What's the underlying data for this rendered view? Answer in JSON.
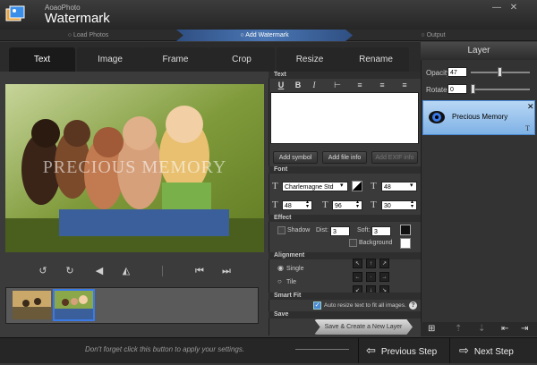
{
  "app": {
    "company": "AoaoPhoto",
    "title": "Watermark"
  },
  "steps": [
    "Load Photos",
    "Add Watermark",
    "Output"
  ],
  "tabs": [
    "Text",
    "Image",
    "Frame",
    "Crop",
    "Resize",
    "Rename"
  ],
  "preview": {
    "watermark_text": "PRECIOUS MEMORY"
  },
  "sections": {
    "text": "Text",
    "font": "Font",
    "effect": "Effect",
    "alignment": "Alignment",
    "smart_fit": "Smart Fit",
    "save": "Save"
  },
  "text_buttons": {
    "add_symbol": "Add symbol",
    "add_file_info": "Add file info",
    "add_exif_info": "Add EXIF info"
  },
  "font": {
    "family": "Charlemagne Std",
    "size": "48",
    "width": "48",
    "height": "96",
    "spacing": "30"
  },
  "effect": {
    "shadow_label": "Shadow",
    "dist_label": "Dist:",
    "dist_value": "3",
    "soft_label": "Soft:",
    "soft_value": "3",
    "background_label": "Background"
  },
  "alignment": {
    "single": "Single",
    "tile": "Tile"
  },
  "smart_fit": {
    "label": "Auto resize text to fit all images."
  },
  "save": {
    "button": "Save & Create a New Layer"
  },
  "layer": {
    "header": "Layer",
    "opacity_label": "Opacity",
    "opacity_value": "47",
    "rotate_label": "Rotate",
    "rotate_value": "0",
    "item_name": "Precious Memory"
  },
  "footer": {
    "hint": "Don't forget click this button to apply your settings.",
    "prev": "Previous Step",
    "next": "Next Step"
  },
  "colors": {
    "accent": "#3a7ae8",
    "step_active": "#4b77b5"
  }
}
